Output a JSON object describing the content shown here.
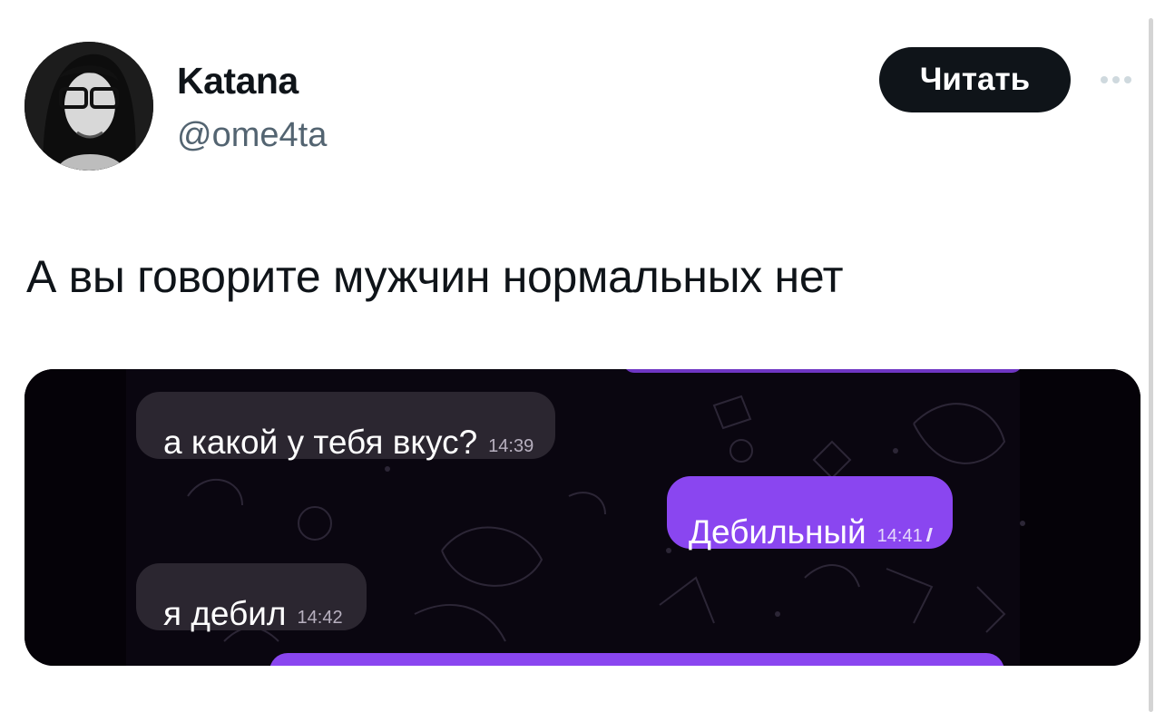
{
  "author": {
    "display_name": "Katana",
    "handle": "@ome4ta"
  },
  "actions": {
    "follow_label": "Читать",
    "more_icon": "more-horizontal-icon"
  },
  "tweet": {
    "text": "А вы говорите мужчин нормальных нет"
  },
  "chat_screenshot": {
    "messages": [
      {
        "direction": "incoming",
        "text": "а какой у тебя вкус?",
        "time": "14:39"
      },
      {
        "direction": "outgoing",
        "text": "Дебильный",
        "time": "14:41",
        "status": "read-double-check-icon"
      },
      {
        "direction": "incoming",
        "text": "я дебил",
        "time": "14:42"
      }
    ],
    "colors": {
      "background": "#050208",
      "incoming_bubble": "#2b2630",
      "outgoing_bubble": "#8a46f0"
    }
  },
  "colors": {
    "follow_button_bg": "#0f1419",
    "handle_text": "#536471"
  }
}
